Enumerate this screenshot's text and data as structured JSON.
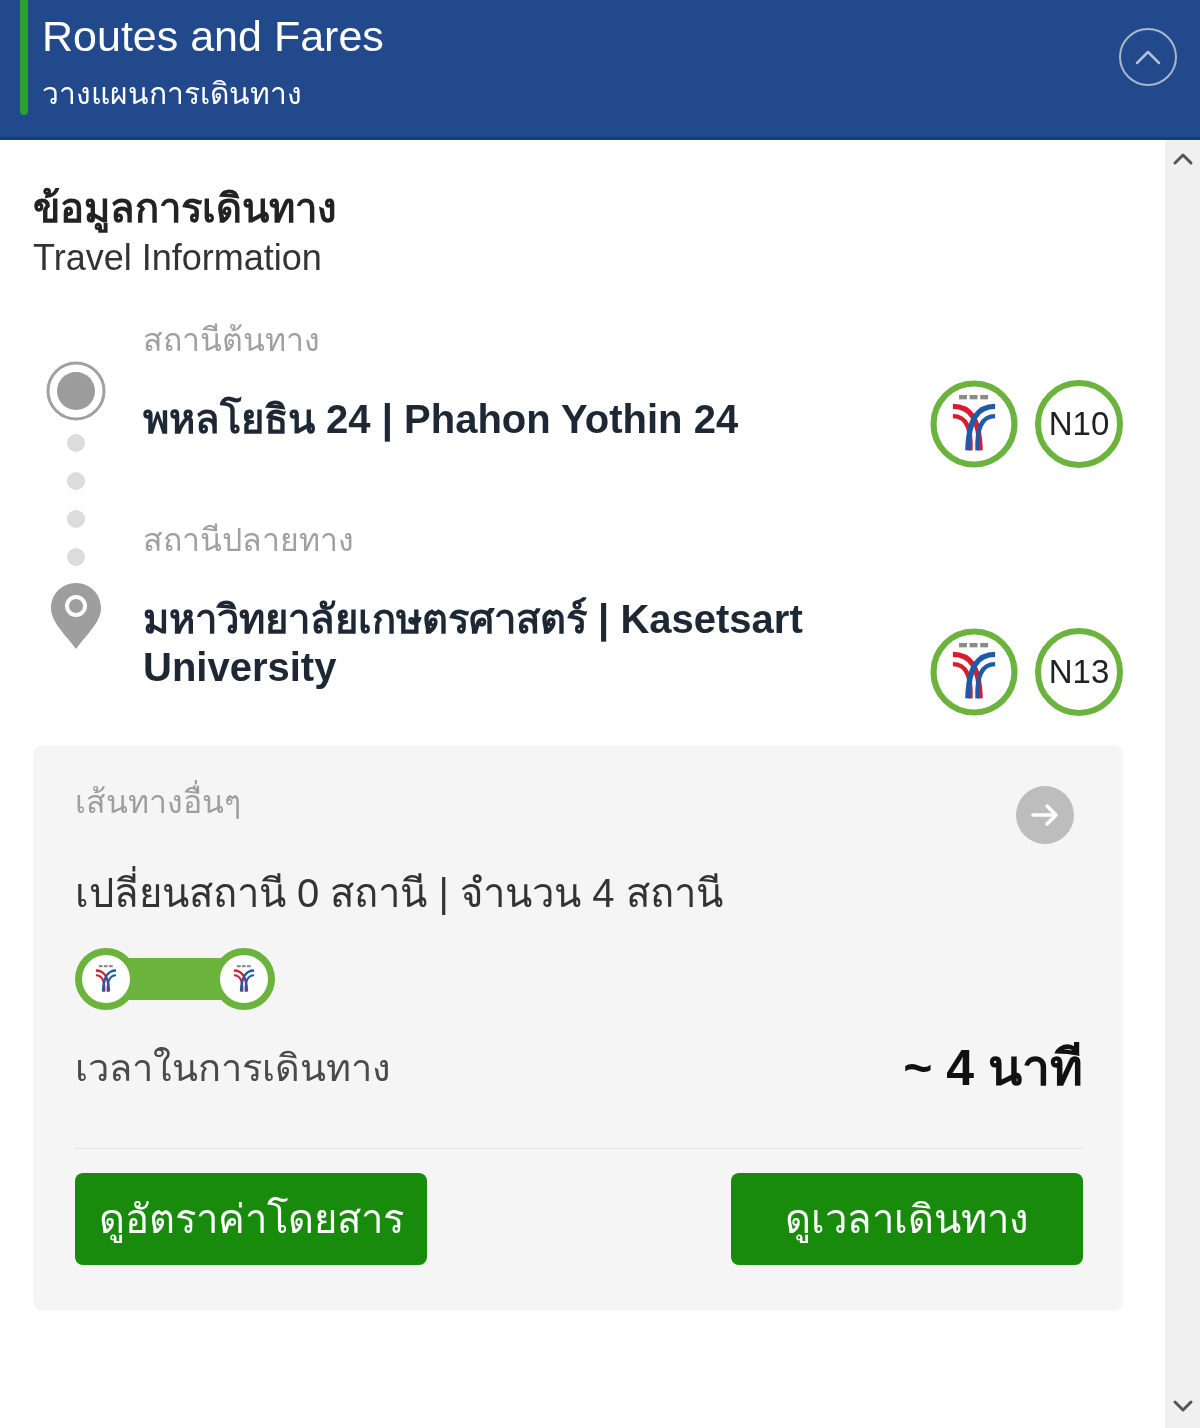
{
  "header": {
    "title": "Routes and Fares",
    "subtitle": "วางแผนการเดินทาง",
    "expanded": true
  },
  "travel_info": {
    "title": "ข้อมูลการเดินทาง",
    "subtitle": "Travel Information"
  },
  "stations": [
    {
      "kind": "origin",
      "label": "สถานีต้นทาง",
      "name": "พหลโยธิน 24 | Phahon Yothin 24",
      "code": "N10"
    },
    {
      "kind": "destination",
      "label": "สถานีปลายทาง",
      "name": "มหาวิทยาลัยเกษตรศาสตร์ | Kasetsart University",
      "code": "N13"
    }
  ],
  "route_card": {
    "heading": "เส้นทางอื่นๆ",
    "summary": "เปลี่ยนสถานี 0 สถานี | จำนวน 4 สถานี",
    "time_label": "เวลาในการเดินทาง",
    "time_value": "~ 4 นาที",
    "buttons": [
      "ดูอัตราค่าโดยสาร",
      "ดูเวลาเดินทาง"
    ]
  }
}
